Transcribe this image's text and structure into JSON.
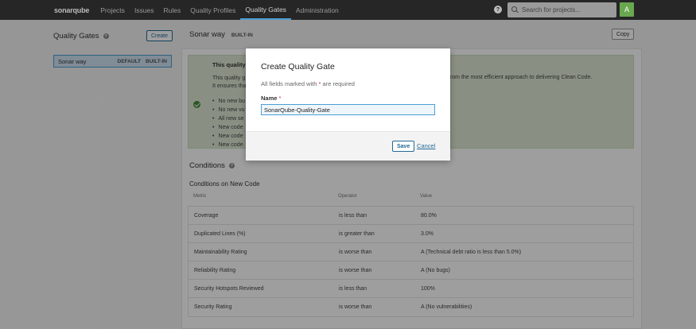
{
  "topnav": {
    "logo": "sonarqube",
    "items": [
      {
        "label": "Projects"
      },
      {
        "label": "Issues"
      },
      {
        "label": "Rules"
      },
      {
        "label": "Quality Profiles"
      },
      {
        "label": "Quality Gates",
        "active": true
      },
      {
        "label": "Administration"
      }
    ],
    "help_icon": "?",
    "search_placeholder": "Search for projects...",
    "avatar_initial": "A"
  },
  "sidebar": {
    "title": "Quality Gates",
    "create_label": "Create",
    "items": [
      {
        "name": "Sonar way",
        "tags": [
          "DEFAULT",
          "BUILT-IN"
        ]
      }
    ]
  },
  "gate": {
    "title": "Sonar way",
    "badge": "BUILT-IN",
    "copy_label": "Copy",
    "info": {
      "title": "This quality",
      "desc_line1": "This quality g",
      "desc_line2": "It ensures tha",
      "right_text": "from the most efficient approach to delivering Clean Code.",
      "bullets": [
        "No new bu",
        "No new vu",
        "All new se",
        "New code",
        "New code",
        "New code"
      ]
    }
  },
  "conditions": {
    "title": "Conditions",
    "subtitle": "Conditions on New Code",
    "columns": [
      "Metric",
      "Operator",
      "Value"
    ],
    "rows": [
      {
        "metric": "Coverage",
        "operator": "is less than",
        "value": "80.0%"
      },
      {
        "metric": "Duplicated Lines (%)",
        "operator": "is greater than",
        "value": "3.0%"
      },
      {
        "metric": "Maintainability Rating",
        "operator": "is worse than",
        "value": "A  (Technical debt ratio is less than 5.0%)"
      },
      {
        "metric": "Reliability Rating",
        "operator": "is worse than",
        "value": "A  (No bugs)"
      },
      {
        "metric": "Security Hotspots Reviewed",
        "operator": "is less than",
        "value": "100%"
      },
      {
        "metric": "Security Rating",
        "operator": "is worse than",
        "value": "A  (No vulnerabilities)"
      }
    ]
  },
  "modal": {
    "title": "Create Quality Gate",
    "note_prefix": "All fields marked with ",
    "note_star": "*",
    "note_suffix": " are required",
    "name_label": "Name",
    "name_star": "*",
    "name_value": "SonarQube-Quality-Gate",
    "save_label": "Save",
    "cancel_label": "Cancel"
  },
  "colors": {
    "nav_bg": "#262626",
    "accent": "#236a97",
    "active_tab_underline": "#4b9fd5",
    "info_box": "#dde9d4",
    "avatar": "#6aa84f"
  }
}
